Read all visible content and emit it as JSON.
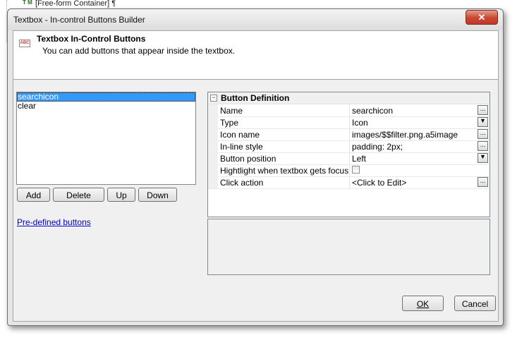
{
  "background": {
    "container_label": "[Free-form Container] ¶",
    "icon_letters": "T M"
  },
  "dialog": {
    "title": "Textbox - In-control Buttons Builder",
    "close_symbol": "✕",
    "header_title": "Textbox In-Control Buttons",
    "header_subtitle": "You can add buttons that appear inside the textbox.",
    "header_icon": "ABC"
  },
  "buttons_list": [
    "searchicon",
    "clear"
  ],
  "actions": {
    "add": "Add",
    "delete": "Delete",
    "up": "Up",
    "down": "Down"
  },
  "predefined_link": "Pre-defined buttons",
  "property_grid": {
    "category": "Button Definition",
    "rows": [
      {
        "name": "Name",
        "value": "searchicon",
        "editor": "ellipsis"
      },
      {
        "name": "Type",
        "value": "Icon",
        "editor": "dropdown"
      },
      {
        "name": "Icon name",
        "value": "images/$$filter.png.a5image",
        "editor": "ellipsis"
      },
      {
        "name": "In-line style",
        "value": "padding: 2px;",
        "editor": "ellipsis"
      },
      {
        "name": "Button position",
        "value": "Left",
        "editor": "dropdown"
      },
      {
        "name": "Hightlight when textbox gets focus",
        "value": "",
        "editor": "checkbox"
      },
      {
        "name": "Click action",
        "value": "<Click to Edit>",
        "editor": "ellipsis"
      }
    ]
  },
  "footer": {
    "ok": "OK",
    "cancel": "Cancel"
  }
}
